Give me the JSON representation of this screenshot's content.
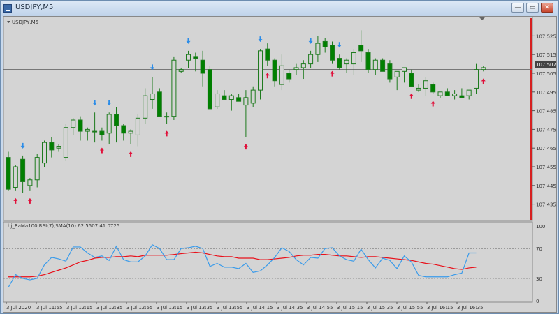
{
  "window": {
    "title": "USDJPY,M5",
    "minimize_glyph": "—",
    "maximize_glyph": "▭",
    "close_glyph": "✕"
  },
  "main_chart": {
    "symbol_label": "USDJPY,M5",
    "current_price_label": "107.507",
    "price_ticks": [
      "107.525",
      "107.515",
      "107.505",
      "107.495",
      "107.485",
      "107.475",
      "107.465",
      "107.455",
      "107.445",
      "107.435"
    ]
  },
  "indicator": {
    "label": "hj_RaMa100 RSI(7),SMA(10) 62.5507 41.0725",
    "scale_ticks": [
      "100",
      "70",
      "30",
      "0"
    ]
  },
  "time_axis": {
    "labels": [
      "3 Jul 2020",
      "3 Jul 11:55",
      "3 Jul 12:15",
      "3 Jul 12:35",
      "3 Jul 12:55",
      "3 Jul 13:15",
      "3 Jul 13:35",
      "3 Jul 13:55",
      "3 Jul 14:15",
      "3 Jul 14:35",
      "3 Jul 14:55",
      "3 Jul 15:15",
      "3 Jul 15:35",
      "3 Jul 15:55",
      "3 Jul 16:15",
      "3 Jul 16:35"
    ]
  },
  "colors": {
    "bull_fill": "#d4d4d4",
    "bear_fill": "#008000",
    "candle_outline": "#1e7b1e",
    "buy_arrow": "#e0103a",
    "sell_arrow": "#2b8ce8",
    "rsi_line": "#3a9bea",
    "sma_line": "#e8101a",
    "price_line": "#6a6a6a",
    "right_border": "#d62020"
  },
  "chart_data": {
    "type": "candlestick",
    "symbol": "USDJPY",
    "timeframe": "M5",
    "ylim": [
      107.43,
      107.53
    ],
    "candles": [
      {
        "o": 107.46,
        "h": 107.463,
        "l": 107.442,
        "c": 107.443
      },
      {
        "o": 107.444,
        "h": 107.456,
        "l": 107.442,
        "c": 107.455
      },
      {
        "o": 107.459,
        "h": 107.461,
        "l": 107.441,
        "c": 107.447
      },
      {
        "o": 107.445,
        "h": 107.449,
        "l": 107.442,
        "c": 107.448
      },
      {
        "o": 107.448,
        "h": 107.462,
        "l": 107.444,
        "c": 107.46
      },
      {
        "o": 107.457,
        "h": 107.469,
        "l": 107.455,
        "c": 107.468
      },
      {
        "o": 107.468,
        "h": 107.471,
        "l": 107.46,
        "c": 107.464
      },
      {
        "o": 107.465,
        "h": 107.467,
        "l": 107.463,
        "c": 107.466
      },
      {
        "o": 107.46,
        "h": 107.478,
        "l": 107.458,
        "c": 107.476
      },
      {
        "o": 107.476,
        "h": 107.481,
        "l": 107.472,
        "c": 107.48
      },
      {
        "o": 107.48,
        "h": 107.482,
        "l": 107.469,
        "c": 107.474
      },
      {
        "o": 107.474,
        "h": 107.476,
        "l": 107.469,
        "c": 107.475
      },
      {
        "o": 107.474,
        "h": 107.484,
        "l": 107.468,
        "c": 107.474
      },
      {
        "o": 107.474,
        "h": 107.476,
        "l": 107.469,
        "c": 107.472
      },
      {
        "o": 107.473,
        "h": 107.484,
        "l": 107.467,
        "c": 107.483
      },
      {
        "o": 107.483,
        "h": 107.487,
        "l": 107.468,
        "c": 107.477
      },
      {
        "o": 107.477,
        "h": 107.478,
        "l": 107.469,
        "c": 107.473
      },
      {
        "o": 107.473,
        "h": 107.475,
        "l": 107.467,
        "c": 107.474
      },
      {
        "o": 107.472,
        "h": 107.483,
        "l": 107.466,
        "c": 107.481
      },
      {
        "o": 107.481,
        "h": 107.497,
        "l": 107.478,
        "c": 107.493
      },
      {
        "o": 107.491,
        "h": 107.503,
        "l": 107.486,
        "c": 107.494
      },
      {
        "o": 107.495,
        "h": 107.497,
        "l": 107.482,
        "c": 107.482
      },
      {
        "o": 107.482,
        "h": 107.484,
        "l": 107.478,
        "c": 107.482
      },
      {
        "o": 107.482,
        "h": 107.514,
        "l": 107.48,
        "c": 107.512
      },
      {
        "o": 107.506,
        "h": 107.508,
        "l": 107.505,
        "c": 107.507
      },
      {
        "o": 107.512,
        "h": 107.517,
        "l": 107.508,
        "c": 107.515
      },
      {
        "o": 107.514,
        "h": 107.516,
        "l": 107.506,
        "c": 107.513
      },
      {
        "o": 107.512,
        "h": 107.517,
        "l": 107.498,
        "c": 107.505
      },
      {
        "o": 107.507,
        "h": 107.509,
        "l": 107.486,
        "c": 107.486
      },
      {
        "o": 107.487,
        "h": 107.496,
        "l": 107.486,
        "c": 107.494
      },
      {
        "o": 107.493,
        "h": 107.496,
        "l": 107.491,
        "c": 107.491
      },
      {
        "o": 107.491,
        "h": 107.494,
        "l": 107.485,
        "c": 107.493
      },
      {
        "o": 107.492,
        "h": 107.494,
        "l": 107.49,
        "c": 107.49
      },
      {
        "o": 107.488,
        "h": 107.496,
        "l": 107.471,
        "c": 107.492
      },
      {
        "o": 107.489,
        "h": 107.498,
        "l": 107.487,
        "c": 107.496
      },
      {
        "o": 107.496,
        "h": 107.518,
        "l": 107.491,
        "c": 107.517
      },
      {
        "o": 107.518,
        "h": 107.521,
        "l": 107.509,
        "c": 107.512
      },
      {
        "o": 107.512,
        "h": 107.513,
        "l": 107.498,
        "c": 107.501
      },
      {
        "o": 107.499,
        "h": 107.515,
        "l": 107.496,
        "c": 107.509
      },
      {
        "o": 107.505,
        "h": 107.507,
        "l": 107.5,
        "c": 107.502
      },
      {
        "o": 107.507,
        "h": 107.51,
        "l": 107.504,
        "c": 107.508
      },
      {
        "o": 107.508,
        "h": 107.512,
        "l": 107.502,
        "c": 107.51
      },
      {
        "o": 107.51,
        "h": 107.517,
        "l": 107.508,
        "c": 107.515
      },
      {
        "o": 107.515,
        "h": 107.525,
        "l": 107.511,
        "c": 107.521
      },
      {
        "o": 107.522,
        "h": 107.524,
        "l": 107.516,
        "c": 107.519
      },
      {
        "o": 107.52,
        "h": 107.522,
        "l": 107.51,
        "c": 107.512
      },
      {
        "o": 107.513,
        "h": 107.515,
        "l": 107.507,
        "c": 107.508
      },
      {
        "o": 107.51,
        "h": 107.513,
        "l": 107.505,
        "c": 107.512
      },
      {
        "o": 107.51,
        "h": 107.518,
        "l": 107.504,
        "c": 107.516
      },
      {
        "o": 107.52,
        "h": 107.528,
        "l": 107.511,
        "c": 107.517
      },
      {
        "o": 107.516,
        "h": 107.518,
        "l": 107.505,
        "c": 107.507
      },
      {
        "o": 107.507,
        "h": 107.513,
        "l": 107.504,
        "c": 107.512
      },
      {
        "o": 107.512,
        "h": 107.513,
        "l": 107.506,
        "c": 107.506
      },
      {
        "o": 107.51,
        "h": 107.512,
        "l": 107.5,
        "c": 107.502
      },
      {
        "o": 107.503,
        "h": 107.506,
        "l": 107.496,
        "c": 107.506
      },
      {
        "o": 107.506,
        "h": 107.508,
        "l": 107.5,
        "c": 107.508
      },
      {
        "o": 107.505,
        "h": 107.507,
        "l": 107.498,
        "c": 107.498
      },
      {
        "o": 107.496,
        "h": 107.499,
        "l": 107.495,
        "c": 107.497
      },
      {
        "o": 107.497,
        "h": 107.503,
        "l": 107.493,
        "c": 107.501
      },
      {
        "o": 107.499,
        "h": 107.5,
        "l": 107.494,
        "c": 107.495
      },
      {
        "o": 107.493,
        "h": 107.495,
        "l": 107.492,
        "c": 107.495
      },
      {
        "o": 107.495,
        "h": 107.497,
        "l": 107.493,
        "c": 107.493
      },
      {
        "o": 107.493,
        "h": 107.496,
        "l": 107.491,
        "c": 107.494
      },
      {
        "o": 107.493,
        "h": 107.497,
        "l": 107.492,
        "c": 107.492
      },
      {
        "o": 107.493,
        "h": 107.496,
        "l": 107.491,
        "c": 107.496
      },
      {
        "o": 107.497,
        "h": 107.51,
        "l": 107.494,
        "c": 107.507
      },
      {
        "o": 107.507,
        "h": 107.509,
        "l": 107.506,
        "c": 107.508
      }
    ],
    "buy_arrows": [
      1,
      3,
      13,
      17,
      22,
      33,
      36,
      45,
      56,
      59,
      66
    ],
    "sell_arrows": [
      2,
      12,
      14,
      20,
      25,
      35,
      42,
      46
    ],
    "rsi": [
      18,
      35,
      30,
      28,
      30,
      48,
      58,
      56,
      53,
      72,
      72,
      64,
      58,
      60,
      54,
      73,
      55,
      52,
      52,
      60,
      75,
      70,
      55,
      55,
      70,
      71,
      73,
      70,
      46,
      50,
      45,
      45,
      43,
      50,
      38,
      40,
      48,
      58,
      71,
      66,
      55,
      48,
      58,
      57,
      70,
      71,
      60,
      55,
      53,
      69,
      55,
      44,
      57,
      54,
      43,
      60,
      52,
      34,
      32,
      32,
      32,
      32,
      35,
      37,
      64,
      64
    ],
    "sma": [
      32,
      32,
      32,
      32,
      33,
      35,
      38,
      41,
      44,
      48,
      52,
      54,
      57,
      58,
      58,
      59,
      59,
      60,
      59,
      61,
      61,
      61,
      61,
      62,
      63,
      64,
      65,
      64,
      62,
      60,
      59,
      59,
      57,
      57,
      57,
      55,
      55,
      56,
      57,
      58,
      60,
      61,
      61,
      62,
      62,
      61,
      60,
      60,
      59,
      58,
      59,
      59,
      58,
      57,
      56,
      55,
      54,
      52,
      50,
      49,
      47,
      45,
      43,
      42,
      44,
      45
    ],
    "rsi_levels": [
      70,
      30
    ]
  }
}
